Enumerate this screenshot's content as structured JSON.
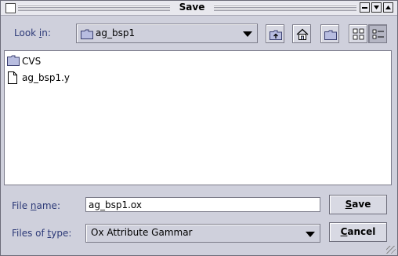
{
  "window": {
    "title": "Save"
  },
  "look_in": {
    "label_pre": "Look ",
    "label_mnemonic": "i",
    "label_post": "n:",
    "value": "ag_bsp1"
  },
  "toolbar": {
    "up_icon": "up-folder-icon",
    "home_icon": "home-icon",
    "new_folder_icon": "new-folder-icon",
    "list_view_icon": "list-view-icon",
    "details_view_icon": "details-view-icon"
  },
  "files": [
    {
      "name": "CVS",
      "icon": "folder-icon"
    },
    {
      "name": "ag_bsp1.y",
      "icon": "file-icon"
    }
  ],
  "file_name": {
    "label_pre": "File ",
    "label_mnemonic": "n",
    "label_post": "ame:",
    "value": "ag_bsp1.ox"
  },
  "file_type": {
    "label_pre": "Files of ",
    "label_mnemonic": "t",
    "label_post": "ype:",
    "value": "Ox Attribute Gammar"
  },
  "buttons": {
    "save_mnemonic": "S",
    "save_rest": "ave",
    "cancel_mnemonic": "C",
    "cancel_rest": "ancel"
  },
  "colors": {
    "accent_label": "#2d3a78",
    "folder_fill": "#b8bde0"
  }
}
